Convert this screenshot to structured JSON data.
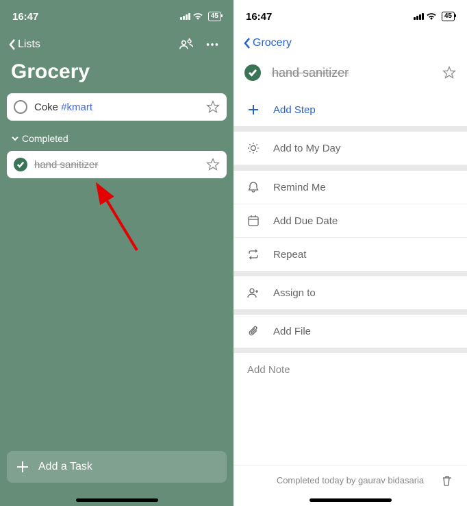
{
  "statusBar": {
    "time": "16:47",
    "battery": "45"
  },
  "left": {
    "back": "Lists",
    "title": "Grocery",
    "task1": {
      "text": "Coke ",
      "tag": "#kmart"
    },
    "completed_header": "Completed",
    "task2": "hand sanitizer",
    "addTask": "Add a Task"
  },
  "right": {
    "back": "Grocery",
    "taskTitle": "hand sanitizer",
    "addStep": "Add Step",
    "addMyDay": "Add to My Day",
    "remind": "Remind Me",
    "dueDate": "Add Due Date",
    "repeat": "Repeat",
    "assign": "Assign to",
    "addFile": "Add File",
    "addNote": "Add Note",
    "footer": "Completed today by gaurav bidasaria"
  }
}
